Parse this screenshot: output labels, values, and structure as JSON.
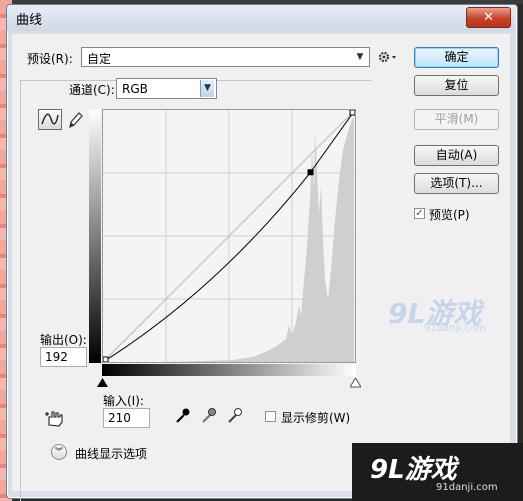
{
  "window": {
    "title": "曲线",
    "close_glyph": "✕"
  },
  "preset": {
    "label": "预设(R):",
    "value": "自定",
    "options_icon": "gear-icon"
  },
  "channel": {
    "label": "通道(C):",
    "value": "RGB"
  },
  "buttons": {
    "ok": "确定",
    "reset": "复位",
    "smooth": "平滑(M)",
    "auto": "自动(A)",
    "options": "选项(T)..."
  },
  "preview": {
    "label": "预览(P)",
    "checked": true
  },
  "output": {
    "label": "输出(O):",
    "value": "192"
  },
  "input": {
    "label": "输入(I):",
    "value": "210"
  },
  "clipping": {
    "label": "显示修剪(W)",
    "checked": false
  },
  "curve_options": {
    "label": "曲线显示选项"
  },
  "tools": [
    "curve-tool-icon",
    "pencil-tool-icon",
    "hand-target-icon",
    "black-eyedropper-icon",
    "gray-eyedropper-icon",
    "white-eyedropper-icon"
  ],
  "curve": {
    "points": [
      [
        0,
        0
      ],
      [
        210,
        192
      ],
      [
        255,
        255
      ]
    ]
  },
  "watermark": {
    "brand": "9L游戏",
    "site": "91danji.com"
  }
}
